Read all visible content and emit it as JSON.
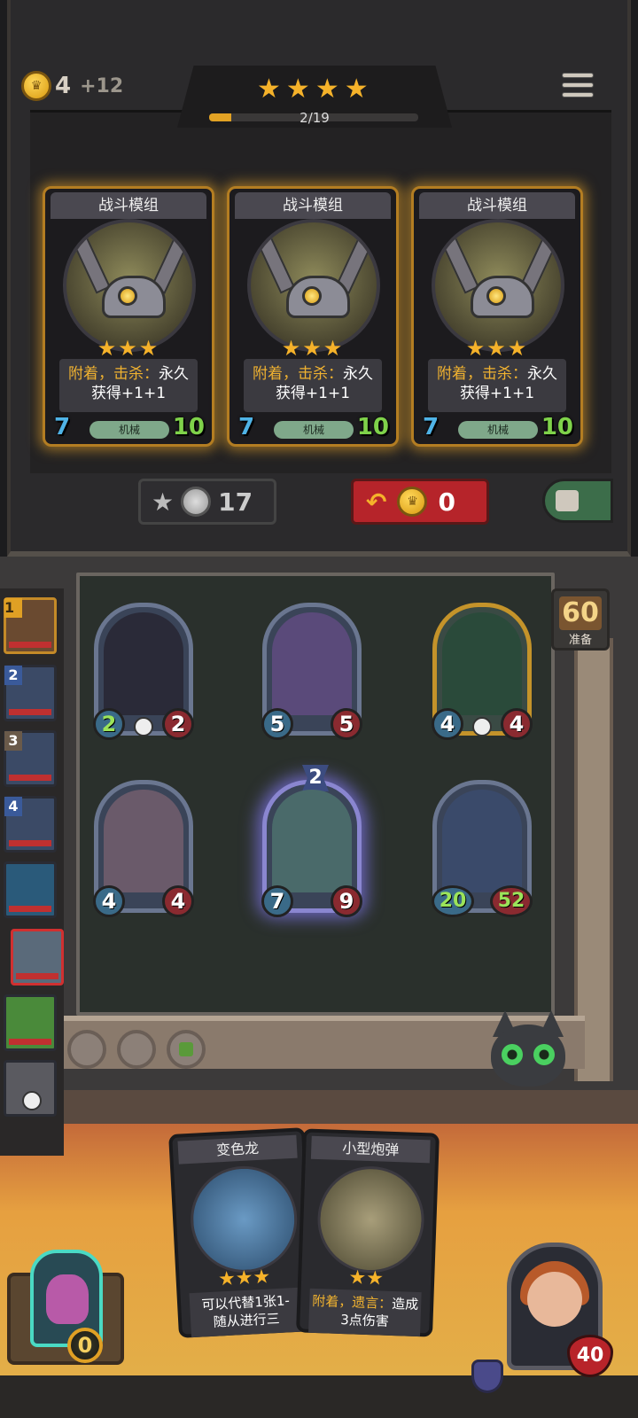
{
  "header": {
    "gold": "4",
    "gold_income": "+12",
    "tier_stars": 4,
    "tier_progress_text": "2/19",
    "tier_progress_fraction": 0.105
  },
  "shop_cards": [
    {
      "name": "战斗模组",
      "stars": "★★★",
      "desc_keyword": "附着，击杀：",
      "desc_rest": "永久",
      "desc_line2": "获得+1+1",
      "type": "机械",
      "attack": "7",
      "health": "10"
    },
    {
      "name": "战斗模组",
      "stars": "★★★",
      "desc_keyword": "附着，击杀：",
      "desc_rest": "永久",
      "desc_line2": "获得+1+1",
      "type": "机械",
      "attack": "7",
      "health": "10"
    },
    {
      "name": "战斗模组",
      "stars": "★★★",
      "desc_keyword": "附着，击杀：",
      "desc_rest": "永久",
      "desc_line2": "获得+1+1",
      "type": "机械",
      "attack": "7",
      "health": "10"
    }
  ],
  "shop_buttons": {
    "upgrade_cost": "17",
    "refresh_cost": "0"
  },
  "prep": {
    "timer": "60",
    "label": "准备"
  },
  "board_minions": [
    {
      "attack": "2",
      "health": "2"
    },
    {
      "attack": "5",
      "health": "5"
    },
    {
      "attack": "4",
      "health": "4"
    },
    {
      "attack": "4",
      "health": "4"
    },
    {
      "attack": "7",
      "health": "9",
      "tier": "2"
    },
    {
      "attack": "20",
      "health": "52"
    }
  ],
  "heroes": [
    {
      "rank": "1"
    },
    {
      "rank": "2"
    },
    {
      "rank": "3"
    },
    {
      "rank": "4"
    }
  ],
  "hand_cards": [
    {
      "name": "变色龙",
      "stars": "★★★",
      "desc_line1": "可以代替1张1-",
      "desc_line2": "随从进行三"
    },
    {
      "name": "小型炮弹",
      "stars": "★★",
      "desc_keyword": "附着，遗言：",
      "desc_rest": "造成",
      "desc_line2": "3点伤害"
    }
  ],
  "player": {
    "buddy_coins": "0",
    "health": "40"
  },
  "colors": {
    "gold_accent": "#f5b22a",
    "refresh_red": "#b6242a",
    "attack_blue": "#4fb3e6",
    "health_green": "#7fd24a"
  }
}
